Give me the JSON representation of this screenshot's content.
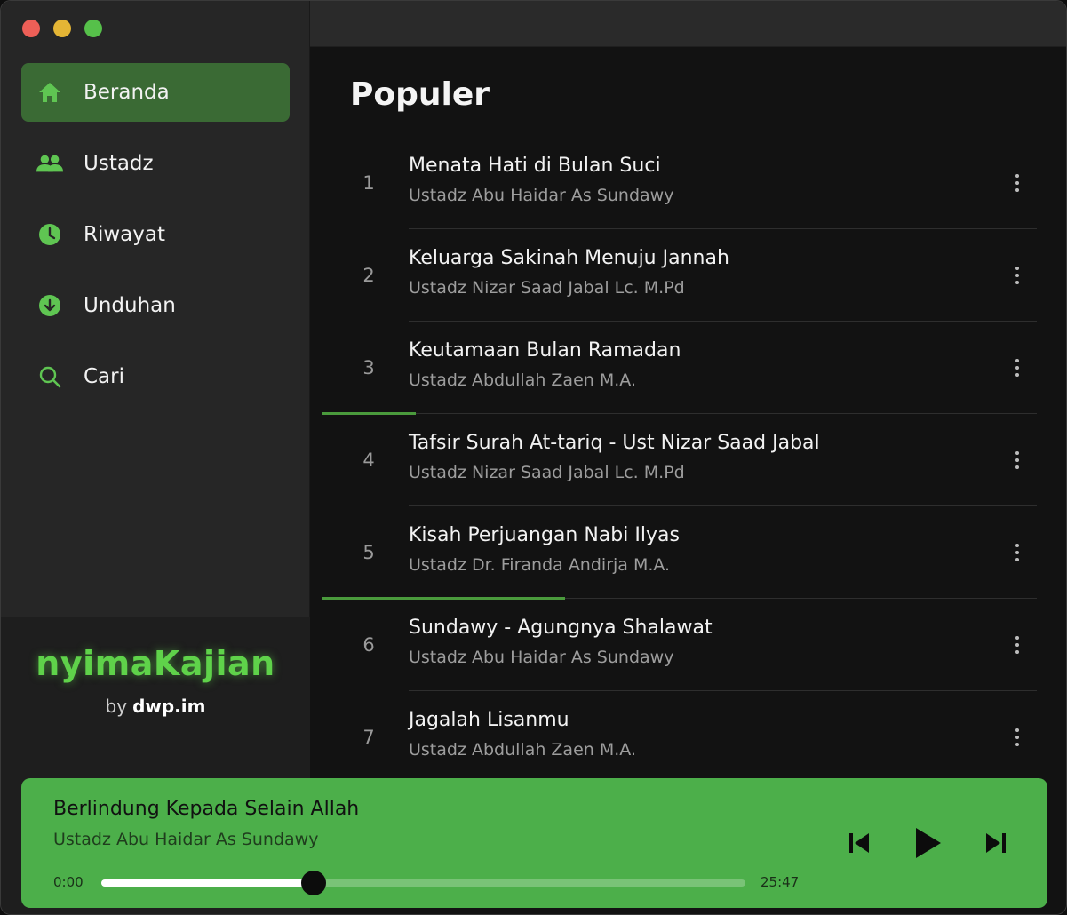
{
  "sidebar": {
    "items": [
      {
        "label": "Beranda",
        "icon": "home-icon",
        "active": true
      },
      {
        "label": "Ustadz",
        "icon": "people-icon",
        "active": false
      },
      {
        "label": "Riwayat",
        "icon": "clock-icon",
        "active": false
      },
      {
        "label": "Unduhan",
        "icon": "download-icon",
        "active": false
      },
      {
        "label": "Cari",
        "icon": "search-icon",
        "active": false
      }
    ],
    "brand": {
      "name": "nyimaKajian",
      "by": "by",
      "site": "dwp.im"
    }
  },
  "main": {
    "title": "Populer",
    "tracks": [
      {
        "num": "1",
        "title": "Menata Hati di Bulan Suci",
        "speaker": "Ustadz Abu Haidar As Sundawy",
        "progress": 0
      },
      {
        "num": "2",
        "title": "Keluarga Sakinah Menuju Jannah",
        "speaker": "Ustadz Nizar Saad Jabal Lc. M.Pd",
        "progress": 0
      },
      {
        "num": "3",
        "title": "Keutamaan Bulan Ramadan",
        "speaker": "Ustadz Abdullah Zaen M.A.",
        "progress": 0.13
      },
      {
        "num": "4",
        "title": "Tafsir Surah At-tariq - Ust Nizar Saad Jabal",
        "speaker": "Ustadz Nizar Saad Jabal Lc. M.Pd",
        "progress": 0
      },
      {
        "num": "5",
        "title": "Kisah Perjuangan Nabi Ilyas",
        "speaker": "Ustadz Dr. Firanda Andirja M.A.",
        "progress": 0.34
      },
      {
        "num": "6",
        "title": "Sundawy - Agungnya Shalawat",
        "speaker": "Ustadz Abu Haidar As Sundawy",
        "progress": 0
      },
      {
        "num": "7",
        "title": "Jagalah Lisanmu",
        "speaker": "Ustadz Abdullah Zaen M.A.",
        "progress": 0
      }
    ]
  },
  "player": {
    "title": "Berlindung Kepada Selain Allah",
    "speaker": "Ustadz Abu Haidar As Sundawy",
    "time_current": "0:00",
    "time_total": "25:47",
    "progress": 0.33
  },
  "colors": {
    "accent": "#4caf4a",
    "brand": "#5fd24a",
    "active_nav": "#3a6a34"
  }
}
